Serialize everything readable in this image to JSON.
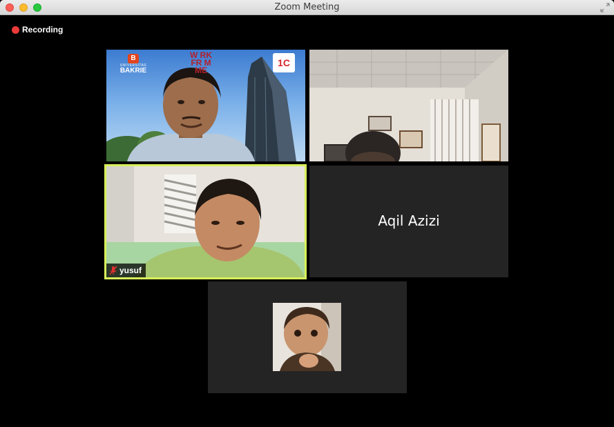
{
  "window": {
    "title": "Zoom Meeting"
  },
  "recording": {
    "label": "Recording",
    "color": "#ec3b3b"
  },
  "banner": {
    "university_line1": "UNIVERSITAS",
    "university_line2": "BAKRIE",
    "wfh_line1": "W RK",
    "wfh_line2": "FR M",
    "wfh_line3": "ME",
    "logo_text": "1C"
  },
  "participants": [
    {
      "id": "p1",
      "video": true
    },
    {
      "id": "p2",
      "video": true
    },
    {
      "id": "p3",
      "video": true,
      "name": "yusuf",
      "muted": true,
      "active_speaker": true,
      "highlight_color": "#d8f05a"
    },
    {
      "id": "p4",
      "video": false,
      "name": "Aqil Azizi"
    },
    {
      "id": "p5",
      "video": false,
      "avatar": "baby-photo"
    }
  ]
}
